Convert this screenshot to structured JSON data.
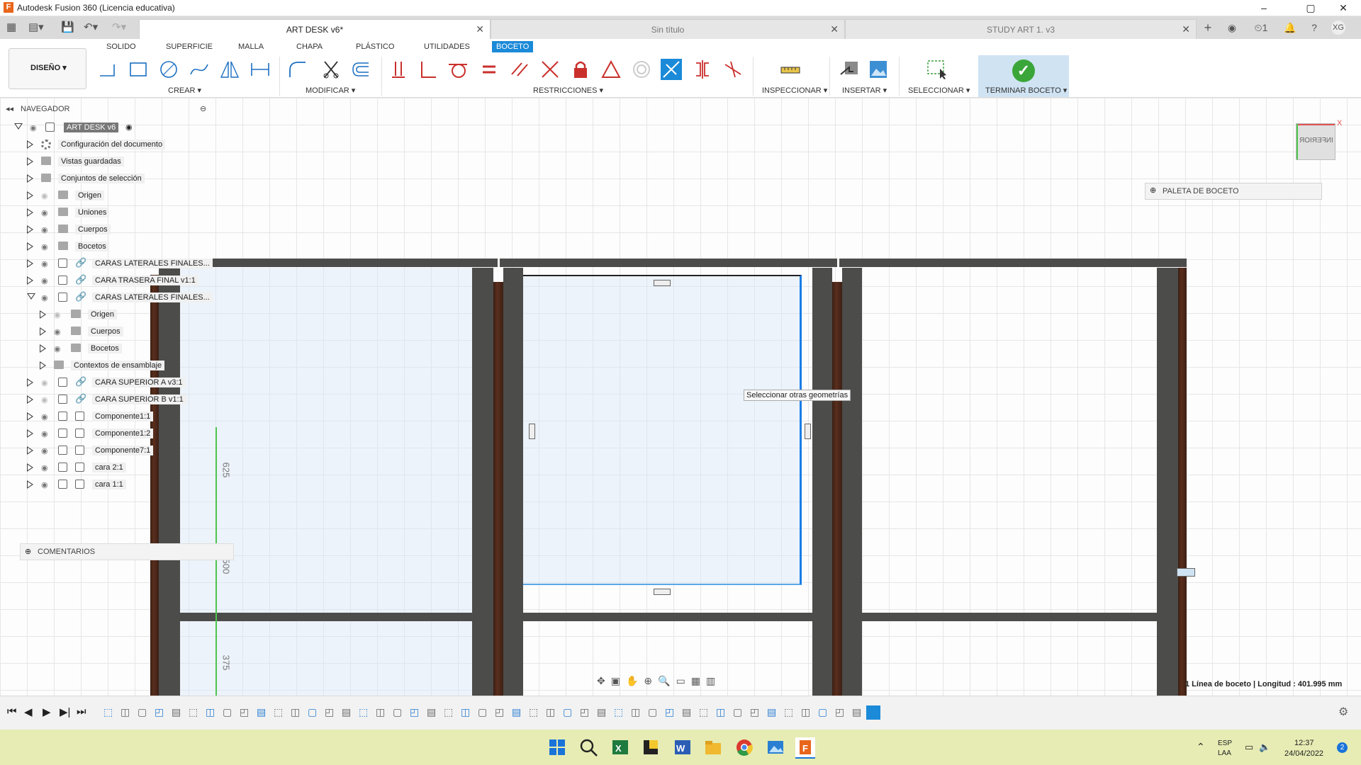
{
  "window": {
    "title": "Autodesk Fusion 360 (Licencia educativa)",
    "min": "–",
    "max": "▢",
    "close": "✕"
  },
  "tabs": [
    {
      "label": "ART DESK v6*",
      "active": true
    },
    {
      "label": "Sin título",
      "active": false
    },
    {
      "label": "STUDY ART 1. v3",
      "active": false
    }
  ],
  "header_right": {
    "jobs": "1",
    "user": "XG"
  },
  "ribbon": {
    "tabs": [
      "SOLIDO",
      "SUPERFICIE",
      "MALLA",
      "CHAPA",
      "PLÁSTICO",
      "UTILIDADES",
      "BOCETO"
    ],
    "active_tab": "BOCETO",
    "workspace": "DISEÑO ▾",
    "groups": {
      "crear": "CREAR ▾",
      "modificar": "MODIFICAR ▾",
      "restricciones": "RESTRICCIONES ▾",
      "inspeccionar": "INSPECCIONAR ▾",
      "insertar": "INSERTAR ▾",
      "seleccionar": "SELECCIONAR ▾",
      "terminar": "TERMINAR BOCETO ▾"
    },
    "accent": "#1b8ad8"
  },
  "browser": {
    "header": "NAVEGADOR",
    "root": "ART DESK v6",
    "items": [
      {
        "label": "Configuración del documento",
        "icon": "gear-icon"
      },
      {
        "label": "Vistas guardadas",
        "icon": "folder-icon"
      },
      {
        "label": "Conjuntos de selección",
        "icon": "folder-icon"
      },
      {
        "label": "Origen",
        "icon": "folder-icon"
      },
      {
        "label": "Uniones",
        "icon": "folder-icon"
      },
      {
        "label": "Cuerpos",
        "icon": "folder-icon"
      },
      {
        "label": "Bocetos",
        "icon": "folder-icon"
      },
      {
        "label": "CARAS LATERALES FINALES...",
        "icon": "link-icon"
      },
      {
        "label": "CARA TRASERA  FINAL v1:1",
        "icon": "link-icon"
      },
      {
        "label": "CARAS LATERALES FINALES...",
        "icon": "link-icon"
      },
      {
        "label": "Origen",
        "icon": "folder-icon"
      },
      {
        "label": "Cuerpos",
        "icon": "folder-icon"
      },
      {
        "label": "Bocetos",
        "icon": "folder-icon"
      },
      {
        "label": "Contextos de ensamblaje",
        "icon": "folder-icon"
      },
      {
        "label": "CARA SUPERIOR A v3:1",
        "icon": "link-icon"
      },
      {
        "label": "CARA SUPERIOR B v1:1",
        "icon": "link-icon"
      },
      {
        "label": "Componente1:1",
        "icon": "component-icon"
      },
      {
        "label": "Componente1:2",
        "icon": "component-icon"
      },
      {
        "label": "Componente7:1",
        "icon": "component-icon"
      },
      {
        "label": "cara 2:1",
        "icon": "component-icon"
      },
      {
        "label": "cara 1:1",
        "icon": "component-icon"
      }
    ],
    "comments": "COMENTARIOS"
  },
  "viewport": {
    "viewcube": "INFERIOR",
    "palette": "PALETA DE BOCETO",
    "tooltip": "Seleccionar otras geometrías",
    "dims": [
      "625",
      "500",
      "375"
    ],
    "status": "1 Línea de boceto | Longitud : 401.995 mm"
  },
  "taskbar": {
    "lang1": "ESP",
    "lang2": "LAA",
    "time": "12:37",
    "date": "24/04/2022",
    "badge": "2"
  }
}
